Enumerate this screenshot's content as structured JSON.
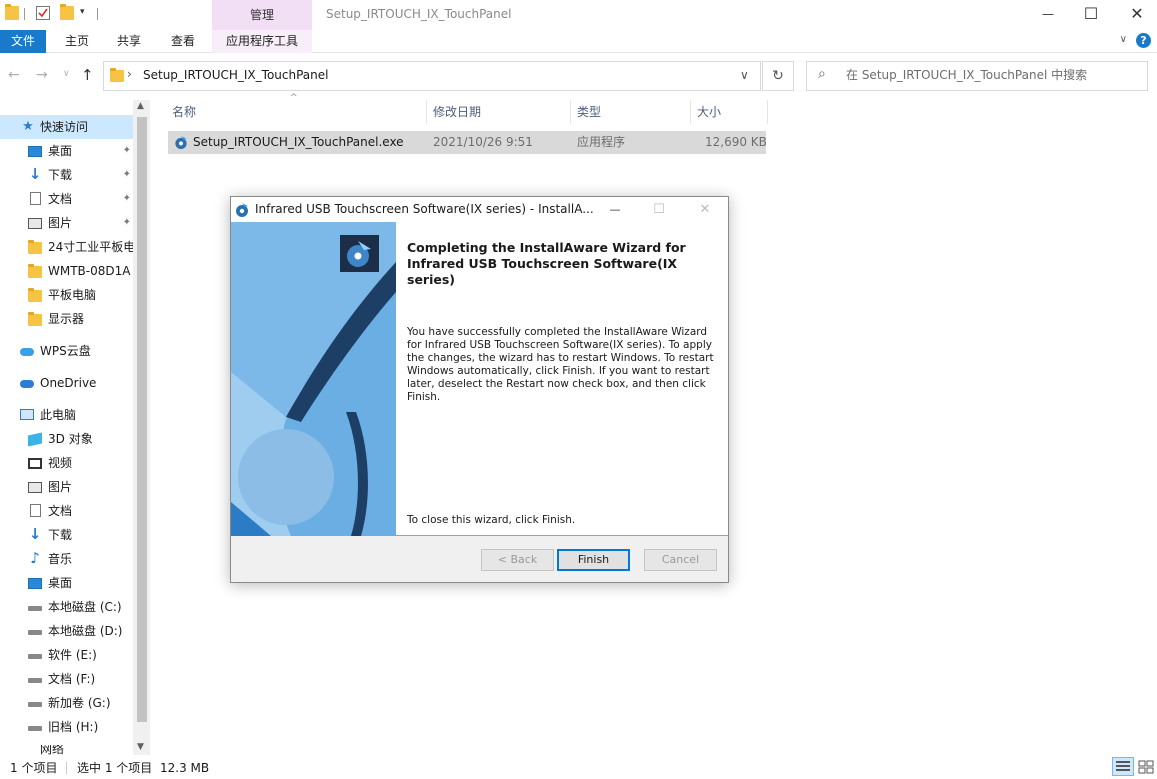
{
  "window": {
    "title": "Setup_IRTOUCH_IX_TouchPanel",
    "manage_label": "管理",
    "minimize_glyph": "—",
    "maximize_glyph": "☐",
    "close_glyph": "✕"
  },
  "ribbon": {
    "tabs": [
      "文件",
      "主页",
      "共享",
      "查看",
      "应用程序工具"
    ],
    "collapse_glyph": "∨",
    "help_glyph": "?"
  },
  "address": {
    "path": "Setup_IRTOUCH_IX_TouchPanel",
    "search_placeholder": "在 Setup_IRTOUCH_IX_TouchPanel 中搜索",
    "back_glyph": "←",
    "forward_glyph": "→",
    "recent_glyph": "∨",
    "up_glyph": "↑",
    "chevron_glyph": "›",
    "dropdown_glyph": "∨",
    "refresh_glyph": "↻",
    "search_glyph": "⌕"
  },
  "sidebar": {
    "items": [
      {
        "label": "快速访问",
        "icon": "star-icon"
      },
      {
        "label": "桌面",
        "icon": "desktop-icon",
        "pinned": true
      },
      {
        "label": "下载",
        "icon": "download-icon",
        "pinned": true
      },
      {
        "label": "文档",
        "icon": "document-icon",
        "pinned": true
      },
      {
        "label": "图片",
        "icon": "pictures-icon",
        "pinned": true
      },
      {
        "label": "24寸工业平板电",
        "icon": "folder-icon"
      },
      {
        "label": "WMTB-08D1A",
        "icon": "folder-icon"
      },
      {
        "label": "平板电脑",
        "icon": "folder-icon"
      },
      {
        "label": "显示器",
        "icon": "folder-icon"
      },
      {
        "label": "WPS云盘",
        "icon": "cloud-icon"
      },
      {
        "label": "OneDrive",
        "icon": "onedrive-icon"
      },
      {
        "label": "此电脑",
        "icon": "pc-icon"
      },
      {
        "label": "3D 对象",
        "icon": "3d-objects-icon"
      },
      {
        "label": "视频",
        "icon": "video-icon"
      },
      {
        "label": "图片",
        "icon": "pictures-icon"
      },
      {
        "label": "文档",
        "icon": "document-icon"
      },
      {
        "label": "下载",
        "icon": "download-icon"
      },
      {
        "label": "音乐",
        "icon": "music-icon"
      },
      {
        "label": "桌面",
        "icon": "desktop-icon"
      },
      {
        "label": "本地磁盘 (C:)",
        "icon": "drive-icon"
      },
      {
        "label": "本地磁盘 (D:)",
        "icon": "drive-icon"
      },
      {
        "label": "软件 (E:)",
        "icon": "drive-icon"
      },
      {
        "label": "文档 (F:)",
        "icon": "drive-icon"
      },
      {
        "label": "新加卷 (G:)",
        "icon": "drive-icon"
      },
      {
        "label": "旧档 (H:)",
        "icon": "drive-icon"
      },
      {
        "label": "网络",
        "icon": "network-icon"
      }
    ],
    "pin_glyph": "📌"
  },
  "columns": [
    "名称",
    "修改日期",
    "类型",
    "大小"
  ],
  "files": [
    {
      "name": "Setup_IRTOUCH_IX_TouchPanel.exe",
      "modified": "2021/10/26 9:51",
      "type": "应用程序",
      "size": "12,690 KB"
    }
  ],
  "dialog": {
    "title": "Infrared USB Touchscreen Software(IX series) - InstallA...",
    "heading_line1": "Completing the InstallAware Wizard for",
    "heading_line2": "Infrared USB Touchscreen Software(IX series)",
    "message": "You have successfully completed the InstallAware Wizard for Infrared USB Touchscreen Software(IX series). To apply the changes, the wizard has to restart Windows. To restart Windows automatically, click Finish. If you want to restart later, deselect the Restart now check box, and then click Finish.",
    "close_hint": "To close this wizard, click Finish.",
    "back_label": "< Back",
    "finish_label": "Finish",
    "cancel_label": "Cancel",
    "minimize_glyph": "—",
    "maximize_glyph": "☐",
    "close_glyph": "✕"
  },
  "status": {
    "item_count": "1 个项目",
    "selected": "选中 1 个项目",
    "size": "12.3 MB"
  }
}
